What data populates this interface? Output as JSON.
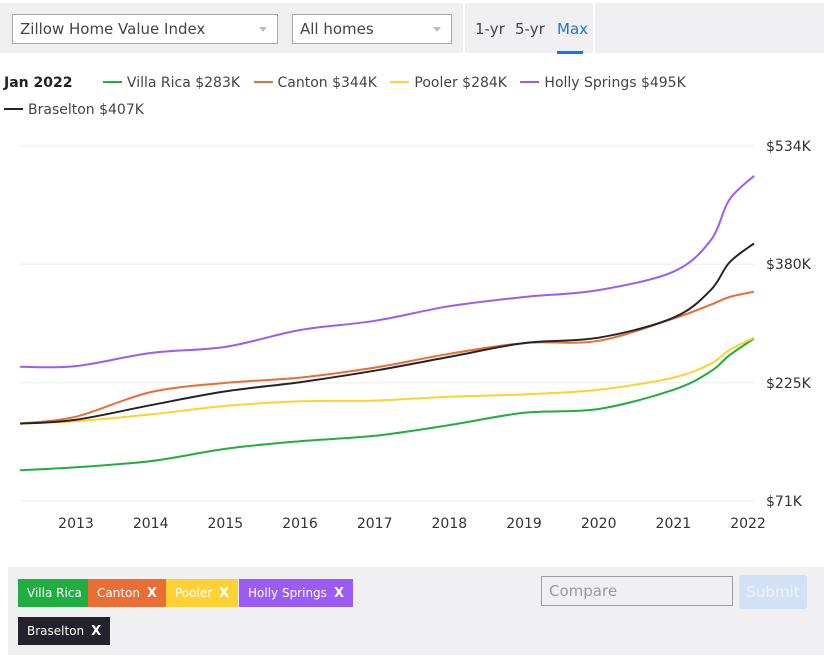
{
  "toolbar": {
    "metric_select": "Zillow Home Value Index",
    "homes_select": "All homes",
    "ranges": [
      "1-yr",
      "5-yr",
      "Max"
    ],
    "active_range": "Max"
  },
  "legend": {
    "date": "Jan 2022",
    "items": [
      {
        "label": "Villa Rica $283K",
        "color": "#1fae3f"
      },
      {
        "label": "Canton $344K",
        "color": "#ea6d34"
      },
      {
        "label": "Pooler $284K",
        "color": "#ffd234"
      },
      {
        "label": "Holly Springs $495K",
        "color": "#9b5cf6"
      },
      {
        "label": "Braselton $407K",
        "color": "#24232b"
      }
    ]
  },
  "chips": [
    {
      "label": "Villa Rica",
      "remove": "",
      "color": "#1fae3f"
    },
    {
      "label": "Canton",
      "remove": "X",
      "color": "#ea6d34"
    },
    {
      "label": "Pooler",
      "remove": "X",
      "color": "#ffd234"
    },
    {
      "label": "Holly Springs",
      "remove": "X",
      "color": "#9b5cf6"
    },
    {
      "label": "Braselton",
      "remove": "X",
      "color": "#24232b"
    }
  ],
  "compare": {
    "placeholder": "Compare",
    "value": "",
    "submit_label": "Submit"
  },
  "chart_data": {
    "type": "line",
    "title": "",
    "xlabel": "",
    "ylabel": "",
    "x": [
      2012.25,
      2013.0,
      2014.0,
      2015.0,
      2016.0,
      2017.0,
      2018.0,
      2019.0,
      2020.0,
      2021.0,
      2021.5,
      2021.75,
      2022.08
    ],
    "x_ticks": [
      "2013",
      "2014",
      "2015",
      "2016",
      "2017",
      "2018",
      "2019",
      "2020",
      "2021",
      "2022"
    ],
    "x_tick_values": [
      2013,
      2014,
      2015,
      2016,
      2017,
      2018,
      2019,
      2020,
      2021,
      2022
    ],
    "xlim": [
      2012.25,
      2022.08
    ],
    "y_ticks": [
      "$534K",
      "$380K",
      "$225K",
      "$71K"
    ],
    "y_tick_values": [
      534,
      380,
      225,
      71
    ],
    "ylim": [
      71,
      534
    ],
    "y_units": "thousands USD",
    "grid": true,
    "legend_position": "top",
    "series": [
      {
        "name": "Villa Rica",
        "color": "#1fae3f",
        "values": [
          111,
          115,
          123,
          139,
          149,
          156,
          170,
          186,
          191,
          216,
          240,
          261,
          283
        ]
      },
      {
        "name": "Canton",
        "color": "#ea6d34",
        "values": [
          172,
          181,
          213,
          225,
          232,
          245,
          263,
          277,
          280,
          309,
          327,
          337,
          344
        ]
      },
      {
        "name": "Pooler",
        "color": "#ffd234",
        "values": [
          172,
          175,
          184,
          195,
          201,
          202,
          207,
          210,
          216,
          232,
          250,
          268,
          284
        ]
      },
      {
        "name": "Holly Springs",
        "color": "#9b5cf6",
        "values": [
          246,
          247,
          264,
          272,
          294,
          306,
          325,
          337,
          346,
          370,
          411,
          464,
          495
        ]
      },
      {
        "name": "Braselton",
        "color": "#24232b",
        "values": [
          172,
          177,
          196,
          214,
          226,
          241,
          259,
          277,
          284,
          310,
          346,
          382,
          407
        ]
      }
    ]
  }
}
